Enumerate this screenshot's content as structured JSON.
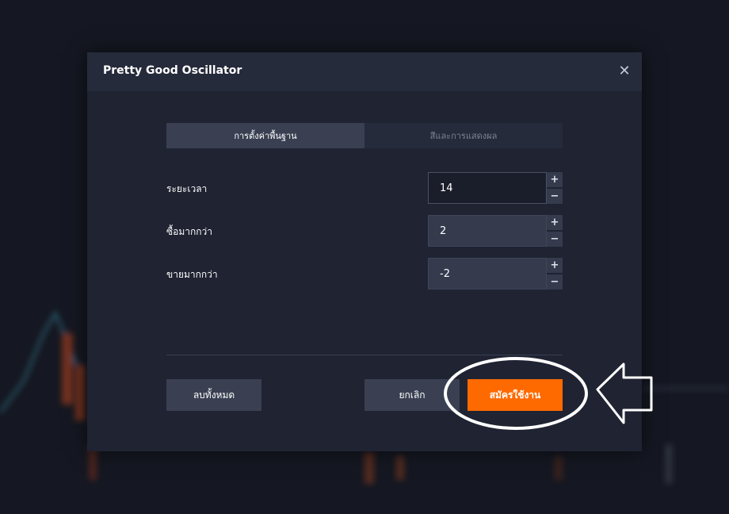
{
  "dialog": {
    "title": "Pretty Good Oscillator",
    "close_symbol": "✕"
  },
  "tabs": [
    {
      "label": "การตั้งค่าพื้นฐาน",
      "active": true
    },
    {
      "label": "สีและการแสดงผล",
      "active": false
    }
  ],
  "settings": [
    {
      "label": "ระยะเวลา",
      "value": "14"
    },
    {
      "label": "ซื้อมากกว่า",
      "value": "2"
    },
    {
      "label": "ขายมากกว่า",
      "value": "-2"
    }
  ],
  "stepper": {
    "plus": "+",
    "minus": "−"
  },
  "buttons": {
    "reset": "ลบทั้งหมด",
    "cancel": "ยกเลิก",
    "apply": "สมัครใช้งาน"
  },
  "colors": {
    "accent": "#ff6a00",
    "dialog_bg": "#1f2332",
    "header_bg": "#262b3b",
    "annotation": "#ffffff"
  },
  "icons": {
    "close": "close-icon",
    "annotation": "arrow-left-icon"
  }
}
